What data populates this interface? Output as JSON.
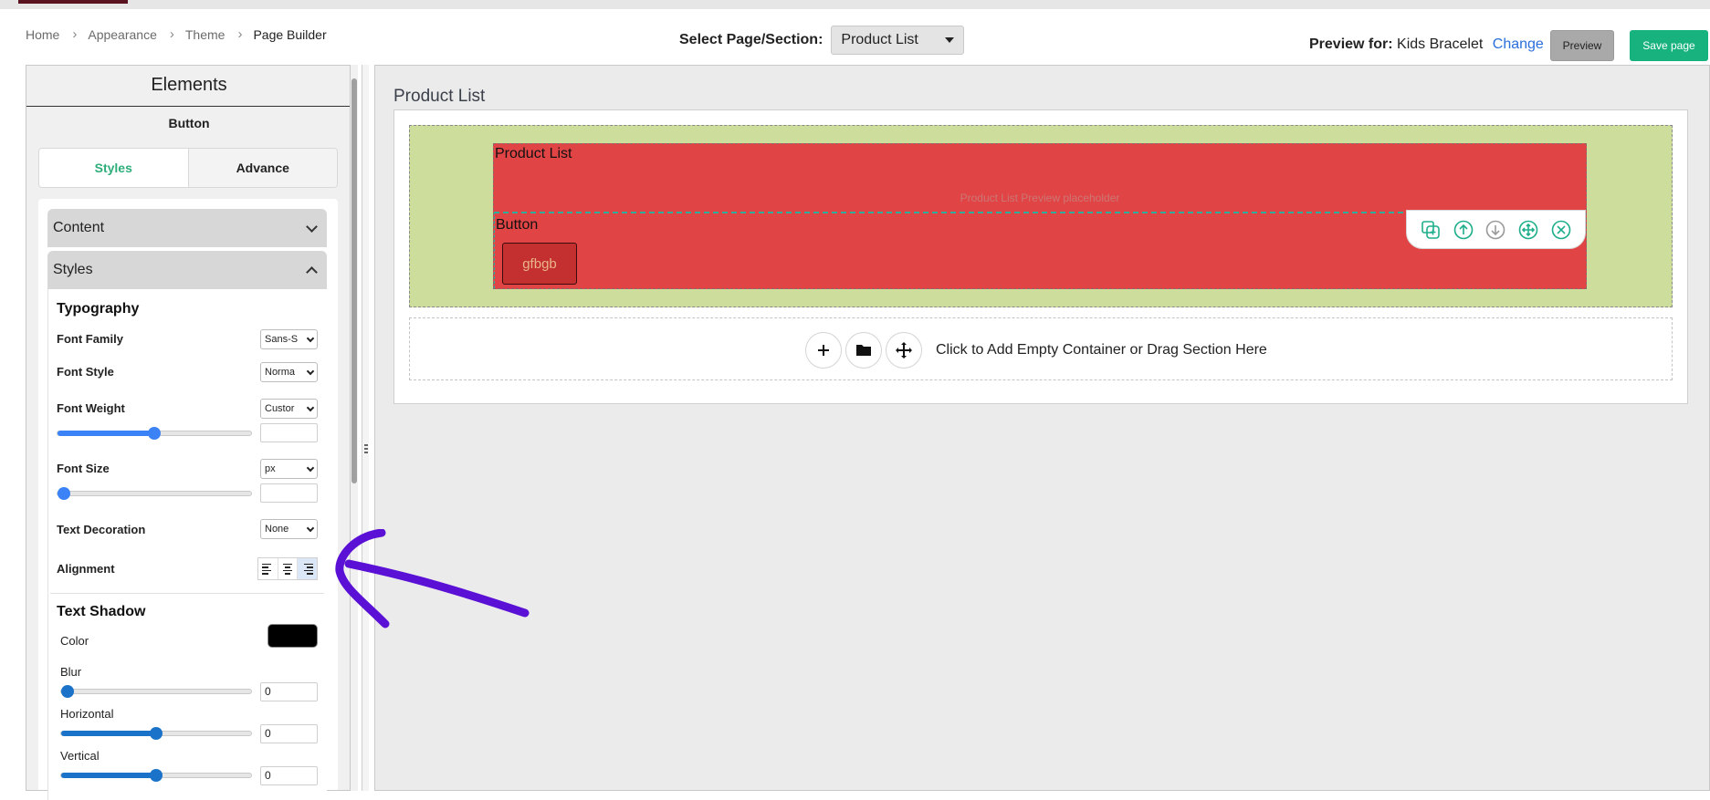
{
  "breadcrumb": [
    "Home",
    "Appearance",
    "Theme",
    "Page Builder"
  ],
  "page_select": {
    "label": "Select Page/Section:",
    "value": "Product List"
  },
  "preview": {
    "label": "Preview for:",
    "product": "Kids Bracelet",
    "change_link": "Change"
  },
  "buttons": {
    "preview": "Preview",
    "save": "Save page"
  },
  "left_panel": {
    "title": "Elements",
    "subtitle": "Button",
    "tabs": [
      "Styles",
      "Advance"
    ],
    "content_header": "Content",
    "styles_header": "Styles",
    "typography": {
      "heading": "Typography",
      "font_family": {
        "label": "Font Family",
        "value": "Sans-S"
      },
      "font_style": {
        "label": "Font Style",
        "value": "Norma"
      },
      "font_weight": {
        "label": "Font Weight",
        "value": "Custor",
        "slider_fraction": 0.5
      },
      "font_size": {
        "label": "Font Size",
        "value": "px",
        "slider_fraction": 0.0
      },
      "text_decoration": {
        "label": "Text Decoration",
        "value": "None"
      },
      "alignment": {
        "label": "Alignment",
        "options": [
          "left",
          "center",
          "right"
        ],
        "selected": "right"
      }
    },
    "text_shadow": {
      "heading": "Text Shadow",
      "color": {
        "label": "Color",
        "value": "#000000"
      },
      "blur": {
        "label": "Blur",
        "value": "0",
        "slider_fraction": 0.0
      },
      "horizontal": {
        "label": "Horizontal",
        "value": "0",
        "slider_fraction": 0.5
      },
      "vertical": {
        "label": "Vertical",
        "value": "0",
        "slider_fraction": 0.5
      }
    }
  },
  "canvas": {
    "title": "Product List",
    "product_list_label": "Product List",
    "placeholder": "Product List Preview placeholder",
    "button_label": "Button",
    "button_text": "gfbgb",
    "toolbar_icons": [
      "duplicate-icon",
      "move-up-icon",
      "move-down-icon",
      "drag-icon",
      "delete-icon"
    ],
    "add_zone_text": "Click to Add Empty Container or Drag Section Here",
    "add_zone_icons": [
      "plus-icon",
      "folder-icon",
      "move-icon"
    ]
  },
  "colors": {
    "accent": "#17b27e",
    "link": "#2a6fdb",
    "annotation": "#5b10d6"
  }
}
